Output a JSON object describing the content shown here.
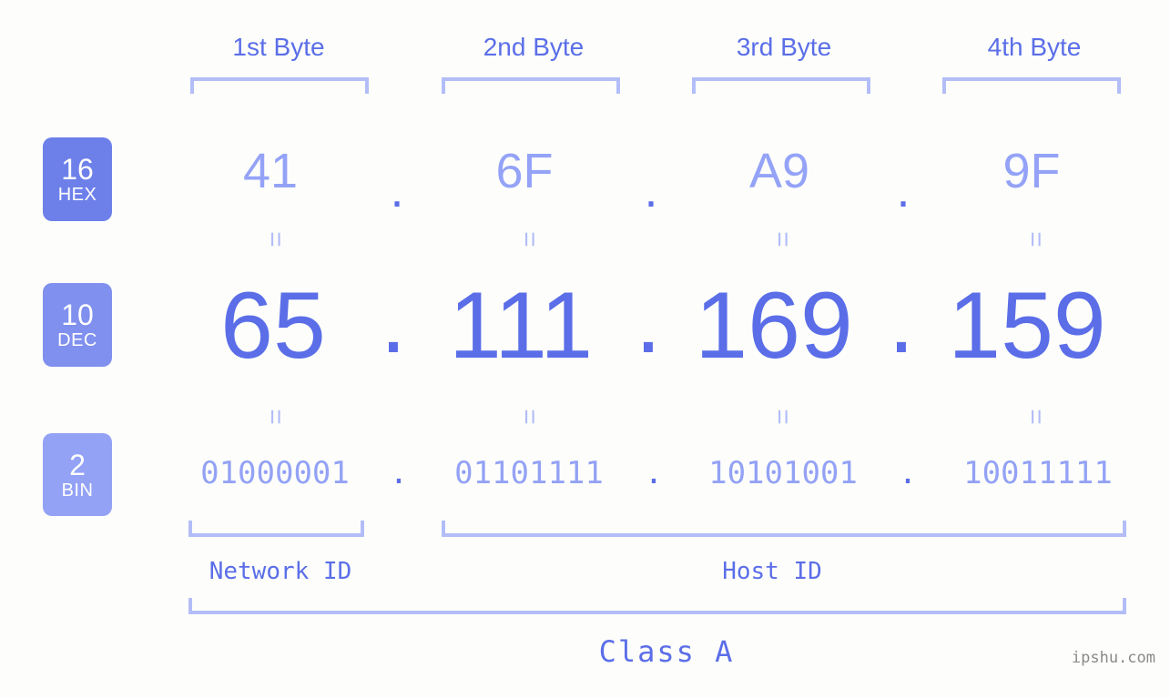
{
  "page": {
    "background_color": "#fdfefb",
    "accent_color": "#5b6ee8",
    "accent_light_color": "#93a2f5",
    "bracket_color": "#b3bdf7"
  },
  "byte_headers": [
    {
      "label": "1st Byte"
    },
    {
      "label": "2nd Byte"
    },
    {
      "label": "3rd Byte"
    },
    {
      "label": "4th Byte"
    }
  ],
  "bases": [
    {
      "number": "16",
      "name": "HEX",
      "color": "#6d80ea"
    },
    {
      "number": "10",
      "name": "DEC",
      "color": "#8090ee"
    },
    {
      "number": "2",
      "name": "BIN",
      "color": "#93a2f5"
    }
  ],
  "rows": {
    "hex": {
      "values": [
        "41",
        "6F",
        "A9",
        "9F"
      ],
      "separator": "."
    },
    "dec": {
      "values": [
        "65",
        "111",
        "169",
        "159"
      ],
      "separator": "."
    },
    "bin": {
      "values": [
        "01000001",
        "01101111",
        "10101001",
        "10011111"
      ],
      "separator": "."
    }
  },
  "equals_sign": "=",
  "sections": {
    "network_id": "Network ID",
    "host_id": "Host ID",
    "class": "Class A"
  },
  "footer": {
    "watermark": "ipshu.com"
  }
}
